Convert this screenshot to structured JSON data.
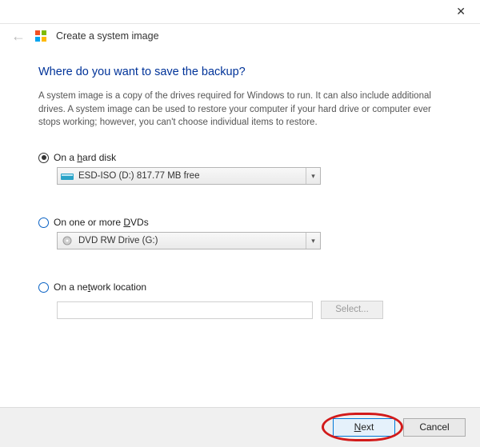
{
  "window": {
    "close": "✕",
    "back": "←",
    "title": "Create a system image"
  },
  "page": {
    "heading": "Where do you want to save the backup?",
    "description": "A system image is a copy of the drives required for Windows to run. It can also include additional drives. A system image can be used to restore your computer if your hard drive or computer ever stops working; however, you can't choose individual items to restore."
  },
  "opt_hd": {
    "label_pre": "On a ",
    "label_key": "h",
    "label_post": "ard disk",
    "combo_value": "ESD-ISO (D:)  817.77 MB free"
  },
  "opt_dvd": {
    "label_pre": "On one or more ",
    "label_key": "D",
    "label_post": "VDs",
    "combo_value": "DVD RW Drive (G:)"
  },
  "opt_net": {
    "label_pre": "On a ne",
    "label_key": "t",
    "label_post": "work location",
    "select_btn": "Select..."
  },
  "footer": {
    "next_pre": "",
    "next_key": "N",
    "next_post": "ext",
    "cancel": "Cancel"
  }
}
